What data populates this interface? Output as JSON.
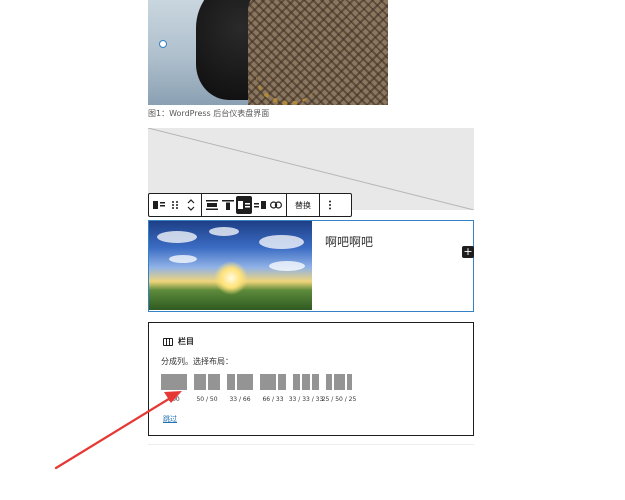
{
  "image_block": {
    "caption": "图1：WordPress 后台仪表盘界面"
  },
  "toolbar": {
    "block_type_icon": "media-text-icon",
    "drag_icon": "drag-handle-icon",
    "move_icon": "move-up-down-icon",
    "align_full_icon": "align-wide-icon",
    "align_top_icon": "vertical-align-top-icon",
    "media_left_icon": "media-left-icon",
    "media_right_icon": "media-right-icon",
    "link_icon": "link-icon",
    "replace_label": "替换",
    "more_icon": "more-vertical-icon"
  },
  "media_text": {
    "text": "啊吧啊吧"
  },
  "inserter": {
    "symbol": "+"
  },
  "columns_placeholder": {
    "title": "栏目",
    "instructions": "分成列。选择布局：",
    "variations": [
      {
        "label": "100",
        "widths": [
          1
        ]
      },
      {
        "label": "50 / 50",
        "widths": [
          1,
          1
        ]
      },
      {
        "label": "33 / 66",
        "widths": [
          1,
          2
        ]
      },
      {
        "label": "66 / 33",
        "widths": [
          2,
          1
        ]
      },
      {
        "label": "33 / 33 / 33",
        "widths": [
          1,
          1,
          1
        ]
      },
      {
        "label": "25 / 50 / 25",
        "widths": [
          1,
          2,
          1
        ]
      }
    ],
    "skip_label": "跳过"
  },
  "annotation": {
    "arrow_color": "#e53935"
  },
  "colors": {
    "accent": "#3582c4",
    "link": "#2271b1",
    "dark": "#1e1e1e"
  }
}
